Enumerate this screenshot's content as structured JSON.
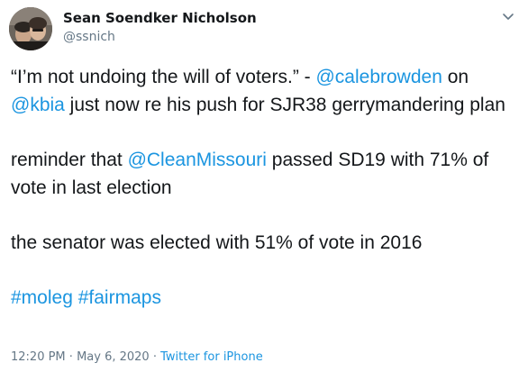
{
  "author": {
    "name": "Sean Soendker Nicholson",
    "handle": "@ssnich",
    "avatar_icon": "profile-photo"
  },
  "menu_icon": "chevron-down-icon",
  "tweet": {
    "p1": {
      "t1": "“I’m not undoing the will of voters.” - ",
      "mention1": "@calebrowden",
      "t2": " on",
      "mention2": "@kbia",
      "t3": " just now re his push for SJR38 gerrymandering plan"
    },
    "p2": {
      "t1": "reminder that ",
      "mention": "@CleanMissouri",
      "t2": " passed SD19 with 71% of vote in last election"
    },
    "p3": {
      "t1": "the senator was elected with 51% of vote in 2016"
    },
    "p4": {
      "hashtag1": "#moleg",
      "space": " ",
      "hashtag2": "#fairmaps"
    }
  },
  "meta": {
    "time": "12:20 PM",
    "sep1": " · ",
    "date": "May 6, 2020",
    "sep2": " · ",
    "source": "Twitter for iPhone"
  },
  "colors": {
    "link": "#1b95e0",
    "text": "#14171a",
    "secondary": "#657786"
  }
}
